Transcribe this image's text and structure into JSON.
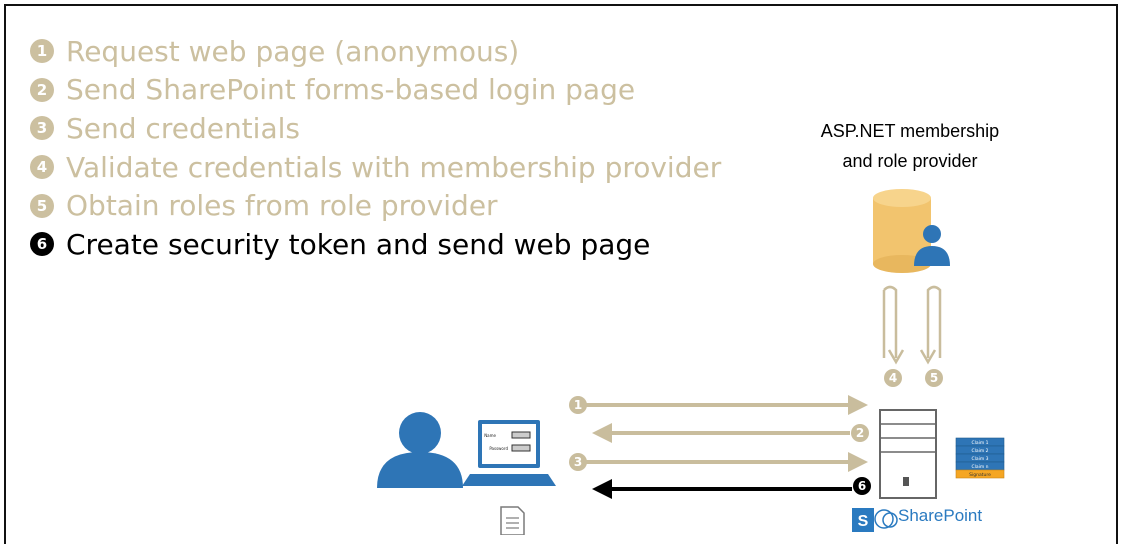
{
  "steps": [
    {
      "number": "1",
      "text": "Request web page (anonymous)",
      "active": false
    },
    {
      "number": "2",
      "text": "Send SharePoint forms-based login page",
      "active": false
    },
    {
      "number": "3",
      "text": "Send credentials",
      "active": false
    },
    {
      "number": "4",
      "text": "Validate credentials with membership provider",
      "active": false
    },
    {
      "number": "5",
      "text": "Obtain roles from role provider",
      "active": false
    },
    {
      "number": "6",
      "text": "Create security token and send web page",
      "active": true
    }
  ],
  "provider": {
    "line1": "ASP.NET membership",
    "line2": "and role provider"
  },
  "flow_labels": {
    "arrow_1": "1",
    "arrow_2": "2",
    "arrow_3": "3",
    "arrow_4": "4",
    "arrow_5": "5",
    "arrow_6": "6"
  },
  "login_form": {
    "field1_label": "Name",
    "field2_label": "Password"
  },
  "token": {
    "claims": [
      "Claim 1",
      "Claim 2",
      "Claim 3",
      "Claim n"
    ],
    "signature": "Signature"
  },
  "sharepoint": {
    "logo_letter": "S",
    "label": "SharePoint"
  },
  "colors": {
    "inactive_text": "#ccc0a0",
    "active_text": "#000000",
    "arrow_inactive": "#c9bd9d",
    "arrow_active": "#000000",
    "user_blue": "#2e75b6",
    "database_gold": "#f2c46e",
    "token_blue": "#2e75b6",
    "signature_orange": "#f5a623",
    "sharepoint_blue": "#2a7ac0"
  }
}
